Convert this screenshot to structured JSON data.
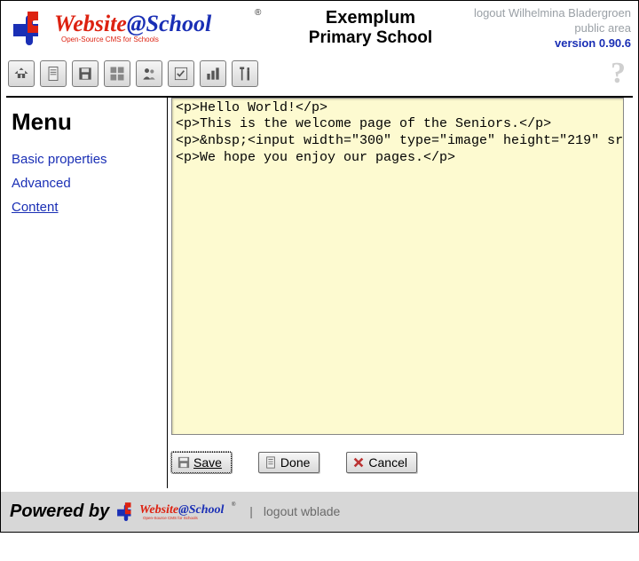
{
  "header": {
    "title_line1": "Exemplum",
    "title_line2": "Primary School",
    "logout_text": "logout Wilhelmina Bladergroen",
    "public_area": "public area",
    "version": "version 0.90.6"
  },
  "sidebar": {
    "menu_heading": "Menu",
    "items": [
      {
        "label": "Basic properties",
        "active": false
      },
      {
        "label": "Advanced",
        "active": false
      },
      {
        "label": "Content",
        "active": true
      }
    ]
  },
  "editor": {
    "content": "<p>Hello World!</p>\n<p>This is the welcome page of the Seniors.</p>\n<p>&nbsp;<input width=\"300\" type=\"image\" height=\"219\" src=\"/file.php/areas/seniors/guidedtour_pupils_seniors.jpg\" /></p>\n<p>We hope you enjoy our pages.</p>"
  },
  "buttons": {
    "save": "Save",
    "done": "Done",
    "cancel": "Cancel"
  },
  "footer": {
    "powered": "Powered by",
    "separator": "|",
    "logout_short": "logout wblade"
  },
  "logo": {
    "brand1": "Website",
    "at": "@",
    "brand2": "School",
    "tagline": "Open-Source CMS for Schools",
    "reg": "®"
  }
}
